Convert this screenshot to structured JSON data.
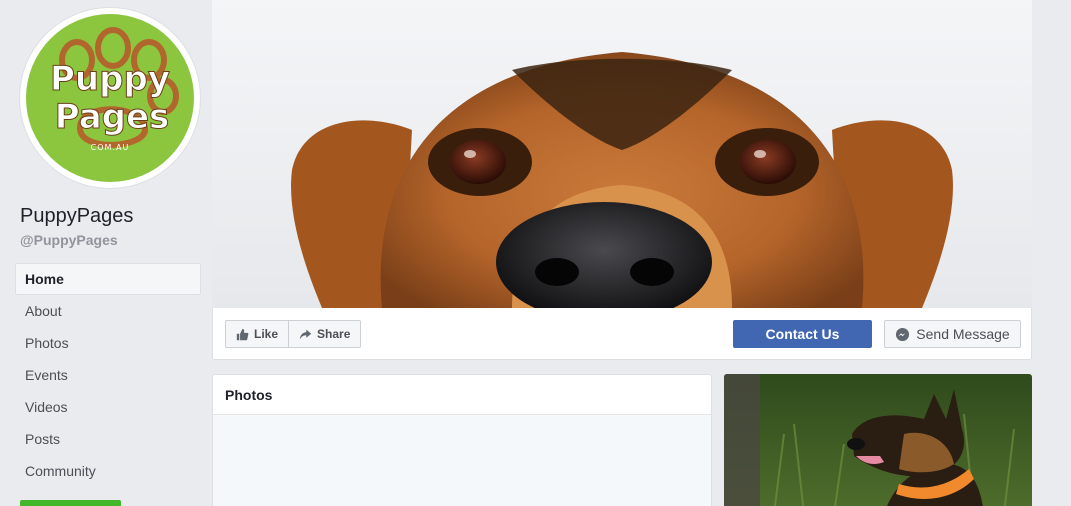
{
  "sidebar": {
    "logo": {
      "line1": "Puppy",
      "line2": "Pages",
      "domain": "COM.AU"
    },
    "page_name": "PuppyPages",
    "page_handle": "@PuppyPages",
    "nav": [
      {
        "label": "Home",
        "active": true
      },
      {
        "label": "About",
        "active": false
      },
      {
        "label": "Photos",
        "active": false
      },
      {
        "label": "Events",
        "active": false
      },
      {
        "label": "Videos",
        "active": false
      },
      {
        "label": "Posts",
        "active": false
      },
      {
        "label": "Community",
        "active": false
      }
    ]
  },
  "actions": {
    "like_label": "Like",
    "share_label": "Share",
    "contact_label": "Contact Us",
    "message_label": "Send Message"
  },
  "photos": {
    "heading": "Photos"
  },
  "colors": {
    "brand_blue": "#4267b2",
    "logo_green": "#8cc63f",
    "cta_green": "#42b72a"
  },
  "icons": [
    "like-icon",
    "share-icon",
    "messenger-icon"
  ]
}
